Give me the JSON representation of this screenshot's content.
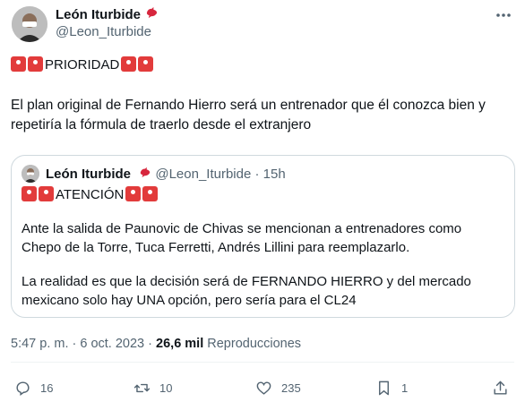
{
  "tweet": {
    "author_name": "León Iturbide",
    "author_handle": "@Leon_Iturbide",
    "headline_text": "PRIORIDAD",
    "body_text": "El plan original de Fernando Hierro será un entrenador que él conozca bien y repetiría la fórmula de traerlo desde el extranjero",
    "timestamp": "5:47 p. m. · 6 oct. 2023",
    "separator": "·",
    "views_count": "26,6 mil",
    "views_label": "Reproducciones"
  },
  "quoted": {
    "author_name": "León Iturbide",
    "author_handle": "@Leon_Iturbide",
    "separator": "·",
    "time": "15h",
    "headline_text": "ATENCIÓN",
    "line1": "Ante la salida de Paunovic de Chivas se mencionan a entrenadores como",
    "line2": "Chepo de la Torre, Tuca Ferretti, Andrés Lillini para reemplazarlo.",
    "line3": "La realidad es que la decisión será de FERNANDO HIERRO y del mercado",
    "line4": "mexicano solo hay UNA opción, pero sería para el CL24"
  },
  "actions": {
    "replies": "16",
    "retweets": "10",
    "likes": "235",
    "bookmarks": "1"
  },
  "icons": [
    "bird-icon",
    "siren-emoji-icon",
    "more-options-icon",
    "reply-icon",
    "retweet-icon",
    "like-icon",
    "bookmark-icon",
    "share-icon"
  ],
  "colors": {
    "text": "#0f1419",
    "muted": "#536471",
    "siren": "#e23b3b",
    "border": "#cfd9de"
  }
}
